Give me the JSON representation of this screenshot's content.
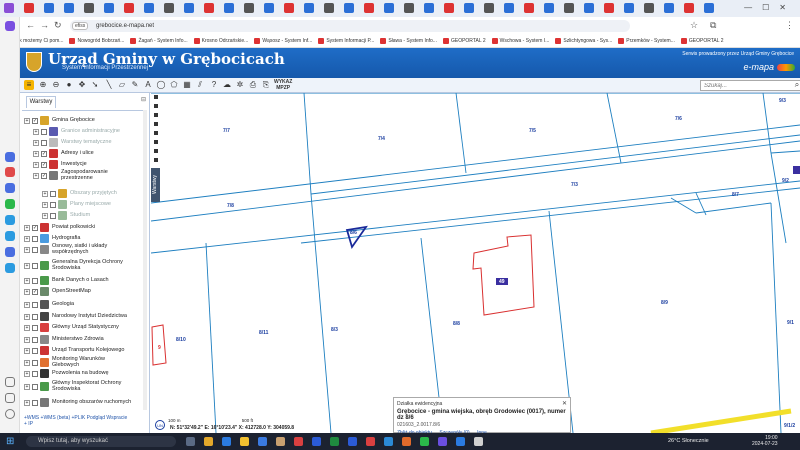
{
  "browser": {
    "url": "grebocice.e-mapa.net",
    "url_badge": "efiss",
    "bookmarks": [
      "Jak możemy Ci pom...",
      "Nowogród Bobrzań...",
      "Żagań - System Info...",
      "Krosno Odrzańskie...",
      "Wąsosz - System Inf...",
      "System Informacji P...",
      "Sława - System Info...",
      "GEOPORTAL 2",
      "Wschowa - System I...",
      "Szlichtyngowa - Sys...",
      "Przemków - System...",
      "GEOPORTAL 2"
    ]
  },
  "header": {
    "title": "Urząd Gminy w Grębocicach",
    "subtitle": "System Informacji Przestrzennej",
    "service_text": "Serwis prowadzony przez Urząd Gminy Grębocice",
    "brand": "e-mapa"
  },
  "toolbar": {
    "wyklad_line1": "WYKAZ",
    "wyklad_line2": "MPZP",
    "search_placeholder": "Szukaj..."
  },
  "layers": {
    "tab_label": "Warstwy",
    "close": "⊟",
    "items": [
      {
        "label": "Gmina Grębocice",
        "grey": false,
        "checked": true
      },
      {
        "label": "Granice administracyjne",
        "grey": true,
        "checked": false
      },
      {
        "label": "Warstwy tematyczne",
        "grey": true,
        "checked": false
      },
      {
        "label": "Adresy i ulice",
        "grey": false,
        "checked": true
      },
      {
        "label": "Inwestycje",
        "grey": false,
        "checked": true
      },
      {
        "label": "Zagospodarowanie przestrzenne",
        "grey": false,
        "checked": true
      },
      {
        "label": "Obszary przyjętych",
        "grey": true,
        "checked": false
      },
      {
        "label": "Plany miejscowe",
        "grey": true,
        "checked": false
      },
      {
        "label": "Studium",
        "grey": true,
        "checked": false
      },
      {
        "label": "Powiat polkowicki",
        "grey": false,
        "checked": true
      },
      {
        "label": "Hydrografia",
        "grey": false,
        "checked": false
      },
      {
        "label": "Osnowy, siatki i układy współrzędnych",
        "grey": false,
        "checked": false
      },
      {
        "label": "Generalna Dyrekcja Ochrony Środowiska",
        "grey": false,
        "checked": false
      },
      {
        "label": "Bank Danych o Lasach",
        "grey": false,
        "checked": false
      },
      {
        "label": "OpenStreetMap",
        "grey": false,
        "checked": true
      },
      {
        "label": "Geologia",
        "grey": false,
        "checked": false
      },
      {
        "label": "Narodowy Instytut Dziedzictwa",
        "grey": false,
        "checked": false
      },
      {
        "label": "Główny Urząd Statystyczny",
        "grey": false,
        "checked": false
      },
      {
        "label": "Ministerstwo Zdrowia",
        "grey": false,
        "checked": false
      },
      {
        "label": "Urząd Transportu Kolejowego",
        "grey": false,
        "checked": false
      },
      {
        "label": "Monitoring Warunków Glebowych",
        "grey": false,
        "checked": false
      },
      {
        "label": "Pozwolenia na budowę",
        "grey": false,
        "checked": false
      },
      {
        "label": "Główny Inspektorat Ochrony Środowiska",
        "grey": false,
        "checked": false
      },
      {
        "label": "Monitoring obszarów ruchomych",
        "grey": false,
        "checked": false
      }
    ],
    "footer": "+WMS  +WMS (beta)  +PLIK  Podgląd  Wspracie",
    "footer2": "+ IP",
    "side_tab": "Warstwy"
  },
  "map": {
    "parcels": [
      "7/7",
      "7/4",
      "7/5",
      "7/6",
      "9/3",
      "7/8",
      "7/3",
      "8/7",
      "9/2",
      "8/6",
      "49",
      "8/9",
      "9",
      "8/10",
      "8/11",
      "8/3",
      "8/8",
      "9/1",
      "9/1/2"
    ]
  },
  "infobox": {
    "header": "Działka ewidencyjna",
    "main": "Grębocice - gmina wiejska, obręb Grodowiec (0017), numer dz 8/6",
    "id": "021603_2.0017.8/6",
    "links": [
      "Zbliż do obiektu",
      "Szczegóły (0)",
      "Inne"
    ],
    "close": "✕"
  },
  "status": {
    "scale": "100 m",
    "scale2": "500 ft",
    "coords": "N: 51°32'49.2\"  E: 16°10'23.4\"  X: 412728.0  Y: 304059.8",
    "logo": "UN"
  },
  "taskbar": {
    "search": "Wpisz tutaj, aby wyszukać",
    "weather": "26°C  Słonecznie",
    "time": "19:00",
    "date": "2024-07-23"
  },
  "colors": {
    "header_blue": "#1558ab",
    "parcel_line": "#1e7fc0",
    "building_red": "#d93030",
    "road_yellow": "#f2df2a"
  }
}
